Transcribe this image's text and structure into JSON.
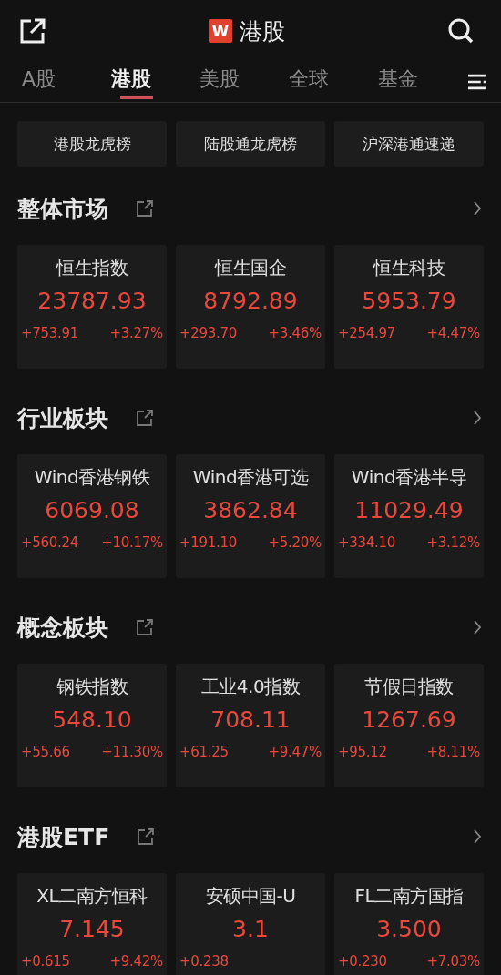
{
  "header": {
    "logo": "W",
    "title": "港股"
  },
  "tabs": [
    {
      "label": "A股",
      "selected": false
    },
    {
      "label": "港股",
      "selected": true
    },
    {
      "label": "美股",
      "selected": false
    },
    {
      "label": "全球",
      "selected": false
    },
    {
      "label": "基金",
      "selected": false
    }
  ],
  "quick_links": [
    "港股龙虎榜",
    "陆股通龙虎榜",
    "沪深港通速递"
  ],
  "sections": [
    {
      "title": "整体市场",
      "cards": [
        {
          "name": "恒生指数",
          "price": "23787.93",
          "change": "+753.91",
          "percent": "+3.27%"
        },
        {
          "name": "恒生国企",
          "price": "8792.89",
          "change": "+293.70",
          "percent": "+3.46%"
        },
        {
          "name": "恒生科技",
          "price": "5953.79",
          "change": "+254.97",
          "percent": "+4.47%"
        }
      ]
    },
    {
      "title": "行业板块",
      "cards": [
        {
          "name": "Wind香港钢铁",
          "price": "6069.08",
          "change": "+560.24",
          "percent": "+10.17%"
        },
        {
          "name": "Wind香港可选",
          "price": "3862.84",
          "change": "+191.10",
          "percent": "+5.20%"
        },
        {
          "name": "Wind香港半导",
          "price": "11029.49",
          "change": "+334.10",
          "percent": "+3.12%"
        }
      ]
    },
    {
      "title": "概念板块",
      "cards": [
        {
          "name": "钢铁指数",
          "price": "548.10",
          "change": "+55.66",
          "percent": "+11.30%"
        },
        {
          "name": "工业4.0指数",
          "price": "708.11",
          "change": "+61.25",
          "percent": "+9.47%"
        },
        {
          "name": "节假日指数",
          "price": "1267.69",
          "change": "+95.12",
          "percent": "+8.11%"
        }
      ]
    },
    {
      "title": "港股ETF",
      "cards": [
        {
          "name": "XL二南方恒科",
          "price": "7.145",
          "change": "+0.615",
          "percent": "+9.42%"
        },
        {
          "name": "安硕中国-U",
          "price": "3.1",
          "change": "+0.238"
        },
        {
          "name": "FL二南方国指",
          "price": "3.500",
          "change": "+0.230",
          "percent": "+7.03%"
        }
      ]
    }
  ]
}
